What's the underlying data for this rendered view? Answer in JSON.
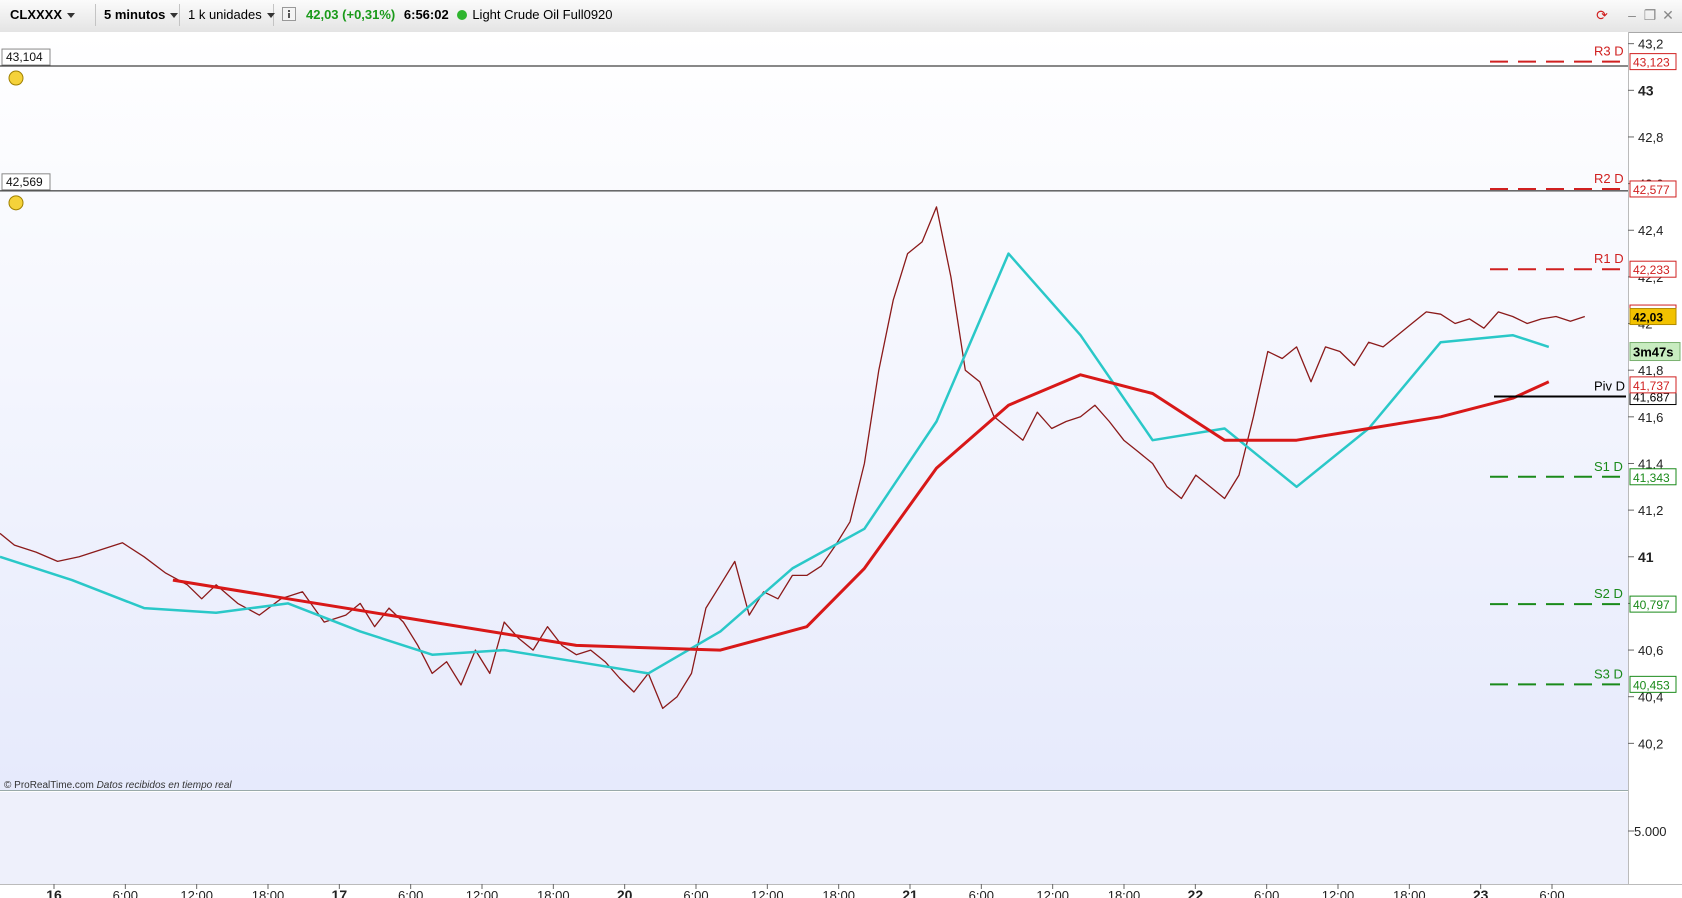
{
  "toolbar": {
    "symbol": "CLXXXX",
    "timeframe": "5 minutos",
    "units": "1 k unidades",
    "info_icon": "info-icon",
    "price_change": "42,03 (+0,31%)",
    "time": "6:56:02",
    "status_color": "#2fb52f",
    "instrument": "Light Crude Oil Full0920"
  },
  "chart_data": {
    "type": "line",
    "title": "",
    "price_axis": {
      "ticks": [
        "43,2",
        "43",
        "42,8",
        "42,6",
        "42,4",
        "42,2",
        "42",
        "41,8",
        "41,6",
        "41,4",
        "41,2",
        "41",
        "40,8",
        "40,6",
        "40,4",
        "40,2"
      ],
      "bold_ticks": [
        "43",
        "41"
      ],
      "ylim": [
        40.0,
        43.25
      ]
    },
    "time_axis": {
      "labels": [
        "16",
        "6:00",
        "12:00",
        "18:00",
        "17",
        "6:00",
        "12:00",
        "18:00",
        "20",
        "6:00",
        "12:00",
        "18:00",
        "21",
        "6:00",
        "12:00",
        "18:00",
        "22",
        "6:00",
        "12:00",
        "18:00",
        "23",
        "6:00"
      ],
      "bold_labels": [
        "16",
        "17",
        "20",
        "21",
        "22",
        "23"
      ]
    },
    "alert_lines": [
      {
        "label": "43,104",
        "value": 43.104
      },
      {
        "label": "42,569",
        "value": 42.569
      }
    ],
    "pivot_levels": [
      {
        "name": "R3 D",
        "value": 43.123,
        "label": "43,123",
        "color": "#d02020"
      },
      {
        "name": "R2 D",
        "value": 42.577,
        "label": "42,577",
        "color": "#d02020"
      },
      {
        "name": "R1 D",
        "value": 42.233,
        "label": "42,233",
        "color": "#d02020"
      },
      {
        "name": "Piv D",
        "value": 41.687,
        "label": "41,687",
        "color": "#000000"
      },
      {
        "name": "S1 D",
        "value": 41.343,
        "label": "41,343",
        "color": "#1a8a1a"
      },
      {
        "name": "S2 D",
        "value": 40.797,
        "label": "40,797",
        "color": "#1a8a1a"
      },
      {
        "name": "S3 D",
        "value": 40.453,
        "label": "40,453",
        "color": "#1a8a1a"
      }
    ],
    "price_labels": [
      {
        "label": "42,045",
        "value": 42.045,
        "color": "#d02020"
      },
      {
        "label": "42,03",
        "value": 42.03,
        "color": "#f2c200"
      },
      {
        "label": "41,737",
        "value": 41.737,
        "color": "#d02020"
      }
    ],
    "countdown": "3m47s",
    "series": [
      {
        "color": "#8b1a1a",
        "x": [
          0,
          2,
          5,
          8,
          11,
          14,
          17,
          20,
          23,
          26,
          28,
          30,
          33,
          36,
          39,
          42,
          45,
          48,
          50,
          52,
          54,
          56,
          58,
          60,
          62,
          64,
          66,
          68,
          70,
          72,
          74,
          76,
          78,
          80,
          82,
          84,
          86,
          88,
          90,
          92,
          94,
          96,
          98,
          100,
          102,
          104,
          106,
          108,
          110,
          112,
          114,
          116,
          118,
          120,
          122,
          124,
          126,
          128,
          130,
          132,
          134,
          136,
          138,
          140,
          142,
          144,
          146,
          148,
          150,
          152,
          154,
          156,
          158,
          160,
          162,
          164,
          166,
          168,
          170,
          172,
          174,
          176,
          178,
          180,
          182,
          184,
          186,
          188,
          190,
          192,
          194,
          196,
          198,
          200,
          202,
          204,
          206,
          208,
          210,
          212,
          214,
          216,
          218,
          220
        ],
        "y": [
          41.1,
          41.05,
          41.02,
          40.98,
          41.0,
          41.03,
          41.06,
          41.0,
          40.93,
          40.88,
          40.82,
          40.88,
          40.8,
          40.75,
          40.82,
          40.85,
          40.72,
          40.75,
          40.8,
          40.7,
          40.78,
          40.72,
          40.62,
          40.5,
          40.55,
          40.45,
          40.6,
          40.5,
          40.72,
          40.65,
          40.6,
          40.7,
          40.62,
          40.58,
          40.6,
          40.55,
          40.48,
          40.42,
          40.5,
          40.35,
          40.4,
          40.5,
          40.78,
          40.88,
          40.98,
          40.75,
          40.85,
          40.82,
          40.92,
          40.92,
          40.96,
          41.05,
          41.15,
          41.4,
          41.8,
          42.1,
          42.3,
          42.35,
          42.5,
          42.2,
          41.8,
          41.75,
          41.6,
          41.55,
          41.5,
          41.62,
          41.55,
          41.58,
          41.6,
          41.65,
          41.58,
          41.5,
          41.45,
          41.4,
          41.3,
          41.25,
          41.35,
          41.3,
          41.25,
          41.35,
          41.6,
          41.88,
          41.85,
          41.9,
          41.75,
          41.9,
          41.88,
          41.82,
          41.92,
          41.9,
          41.95,
          42.0,
          42.05,
          42.04,
          42.0,
          42.02,
          41.98,
          42.05,
          42.03,
          42.0,
          42.02,
          42.03,
          42.01,
          42.03
        ]
      },
      {
        "color": "#2ac8c8",
        "x": [
          0,
          10,
          20,
          30,
          40,
          50,
          60,
          70,
          80,
          90,
          100,
          110,
          120,
          130,
          140,
          150,
          160,
          170,
          180,
          190,
          200,
          210,
          215
        ],
        "y": [
          41.0,
          40.9,
          40.78,
          40.76,
          40.8,
          40.68,
          40.58,
          40.6,
          40.55,
          40.5,
          40.68,
          40.95,
          41.12,
          41.58,
          42.3,
          41.95,
          41.5,
          41.55,
          41.3,
          41.55,
          41.92,
          41.95,
          41.9
        ]
      },
      {
        "color": "#d81818",
        "x": [
          24,
          40,
          60,
          80,
          100,
          112,
          120,
          130,
          140,
          150,
          160,
          170,
          180,
          190,
          200,
          210,
          215
        ],
        "y": [
          40.9,
          40.82,
          40.72,
          40.62,
          40.6,
          40.7,
          40.95,
          41.38,
          41.65,
          41.78,
          41.7,
          41.5,
          41.5,
          41.55,
          41.6,
          41.68,
          41.75
        ]
      }
    ],
    "volume_axis": {
      "tick": "5.000"
    },
    "source_text": "© ProRealTime.com",
    "source_note": "Datos recibidos en tiempo real"
  }
}
